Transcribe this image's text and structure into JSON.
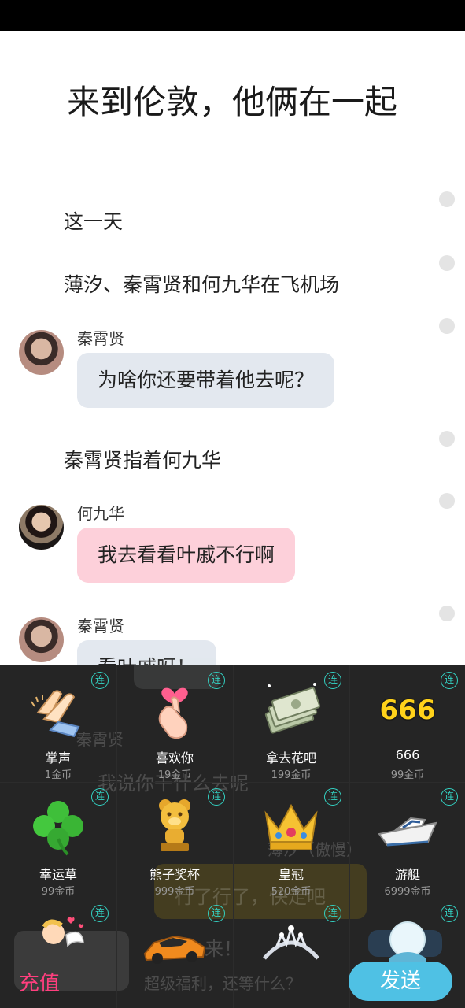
{
  "story": {
    "title": "来到伦敦，他俩在一起",
    "narration": [
      "这一天",
      "薄汐、秦霄贤和何九华在飞机场",
      "秦霄贤指着何九华"
    ],
    "messages": [
      {
        "speaker": "秦霄贤",
        "text": "为啥你还要带着他去呢？"
      },
      {
        "speaker": "何九华",
        "text": "我去看看叶戚不行啊"
      },
      {
        "speaker": "秦霄贤",
        "text": "看叶戚呀！"
      }
    ]
  },
  "background_ghost": {
    "speaker": "秦霄贤",
    "line1": "我说你干什么去呢",
    "speaker2": "薄汐（傲慢）",
    "line2": "行了行了，快走吧",
    "line3": "来！",
    "promo": "超级福利，还等什么？"
  },
  "gifts": {
    "lian_label": "连",
    "items": [
      {
        "name": "掌声",
        "price": "1金币",
        "icon": "clapping-hands-icon"
      },
      {
        "name": "喜欢你",
        "price": "19金币",
        "icon": "finger-heart-icon"
      },
      {
        "name": "拿去花吧",
        "price": "199金币",
        "icon": "money-stack-icon"
      },
      {
        "name": "666",
        "price": "99金币",
        "icon": "666-badge-icon"
      },
      {
        "name": "幸运草",
        "price": "99金币",
        "icon": "clover-icon"
      },
      {
        "name": "熊子奖杯",
        "price": "999金币",
        "icon": "bear-trophy-icon"
      },
      {
        "name": "皇冠",
        "price": "520金币",
        "icon": "crown-icon"
      },
      {
        "name": "游艇",
        "price": "6999金币",
        "icon": "yacht-icon"
      },
      {
        "name": "",
        "price": "",
        "icon": "cupid-icon"
      },
      {
        "name": "",
        "price": "",
        "icon": "sports-car-icon"
      },
      {
        "name": "",
        "price": "",
        "icon": "tiara-icon"
      },
      {
        "name": "",
        "price": "",
        "icon": "snow-globe-icon"
      }
    ]
  },
  "footer": {
    "recharge_label": "充值",
    "send_label": "发送"
  },
  "colors": {
    "recharge": "#ff3f7e",
    "send": "#4fc1e4",
    "lian": "#33d1c2"
  }
}
